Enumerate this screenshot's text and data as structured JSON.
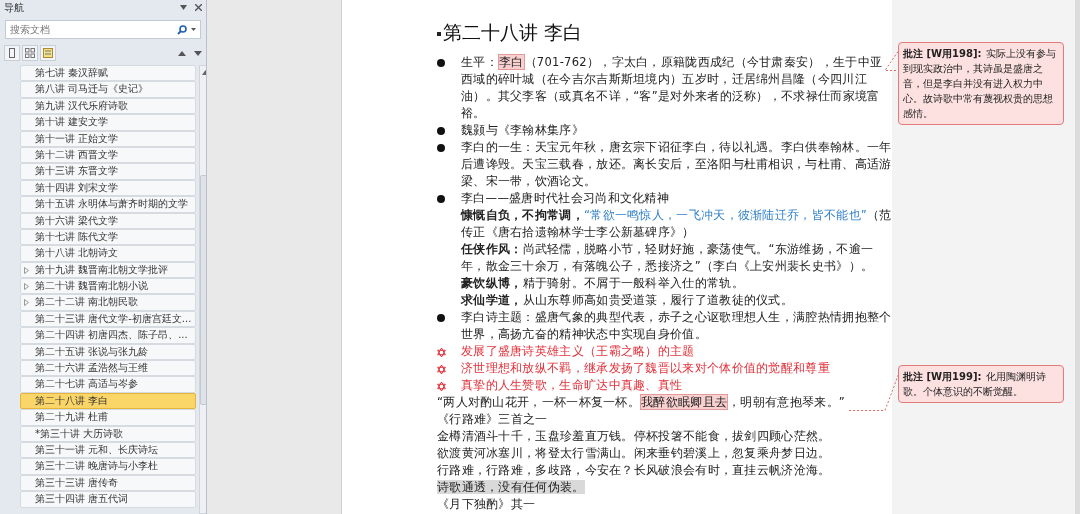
{
  "nav_pane": {
    "title": "导航",
    "search": {
      "placeholder": "搜索文档"
    },
    "items": [
      {
        "label": "第七讲 秦汉辞赋",
        "expandable": false,
        "selected": false
      },
      {
        "label": "第八讲 司马迁与《史记》",
        "expandable": false,
        "selected": false
      },
      {
        "label": "第九讲 汉代乐府诗歌",
        "expandable": false,
        "selected": false
      },
      {
        "label": "第十讲 建安文学",
        "expandable": false,
        "selected": false
      },
      {
        "label": "第十一讲 正始文学",
        "expandable": false,
        "selected": false
      },
      {
        "label": "第十二讲 西晋文学",
        "expandable": false,
        "selected": false
      },
      {
        "label": "第十三讲 东晋文学",
        "expandable": false,
        "selected": false
      },
      {
        "label": "第十四讲 刘宋文学",
        "expandable": false,
        "selected": false
      },
      {
        "label": "第十五讲 永明体与萧齐时期的文学",
        "expandable": false,
        "selected": false
      },
      {
        "label": "第十六讲 梁代文学",
        "expandable": false,
        "selected": false
      },
      {
        "label": "第十七讲 陈代文学",
        "expandable": false,
        "selected": false
      },
      {
        "label": "第十八讲 北朝诗文",
        "expandable": false,
        "selected": false
      },
      {
        "label": "第十九讲 魏晋南北朝文学批评",
        "expandable": true,
        "selected": false
      },
      {
        "label": "第二十讲 魏晋南北朝小说",
        "expandable": true,
        "selected": false
      },
      {
        "label": "第二十二讲 南北朝民歌",
        "expandable": true,
        "selected": false
      },
      {
        "label": "第二十三讲 唐代文学-初唐宫廷文...",
        "expandable": false,
        "selected": false
      },
      {
        "label": "第二十四讲 初唐四杰、陈子昂、...",
        "expandable": false,
        "selected": false
      },
      {
        "label": "第二十五讲 张说与张九龄",
        "expandable": false,
        "selected": false
      },
      {
        "label": "第二十六讲 孟浩然与王维",
        "expandable": false,
        "selected": false
      },
      {
        "label": "第二十七讲 高适与岑参",
        "expandable": false,
        "selected": false
      },
      {
        "label": "第二十八讲 李白",
        "expandable": false,
        "selected": true
      },
      {
        "label": "第二十九讲 杜甫",
        "expandable": false,
        "selected": false
      },
      {
        "label": "*第三十讲 大历诗歌",
        "expandable": false,
        "selected": false
      },
      {
        "label": "第三十一讲 元和、长庆诗坛",
        "expandable": false,
        "selected": false
      },
      {
        "label": "第三十二讲 晚唐诗与小李杜",
        "expandable": false,
        "selected": false
      },
      {
        "label": "第三十三讲 唐传奇",
        "expandable": false,
        "selected": false
      },
      {
        "label": "第三十四讲 唐五代词",
        "expandable": false,
        "selected": false
      }
    ]
  },
  "document": {
    "paragraphs": [
      {
        "kind": "heading",
        "parts": [
          {
            "kind": "plain",
            "text": "第二十八讲 李白"
          }
        ]
      },
      {
        "kind": "bullet",
        "parts": [
          {
            "kind": "plain",
            "text": "生平："
          },
          {
            "kind": "anchor",
            "text": "李白"
          },
          {
            "kind": "plain",
            "text": "（701-762），字太白，原籍陇西成纪（今甘肃秦安），生于中亚西域的碎叶城（在今吉尔吉斯斯坦境内）五岁时，迁居绵州昌隆（今四川江油）。其父李客（或真名不详，“客”是对外来者的泛称），不求禄仕而家境富裕。"
          }
        ]
      },
      {
        "kind": "bullet",
        "parts": [
          {
            "kind": "plain",
            "text": "魏颢与《李翰林集序》"
          }
        ]
      },
      {
        "kind": "bullet",
        "parts": [
          {
            "kind": "plain",
            "text": "李白的一生：天宝元年秋，唐玄宗下诏征李白，待以礼遇。李白供奉翰林。一年后遭谗毁。天宝三载春，放还。离长安后，至洛阳与杜甫相识，与杜甫、高适游梁、宋一带，饮酒论文。"
          }
        ]
      },
      {
        "kind": "bullet",
        "parts": [
          {
            "kind": "plain",
            "text": "李白——盛唐时代社会习尚和文化精神"
          }
        ]
      },
      {
        "kind": "indent",
        "parts": [
          {
            "kind": "bold",
            "text": "慷慨自负，不拘常调，"
          },
          {
            "kind": "blue",
            "text": "“常欲一鸣惊人，一飞冲天，彼渐陆迁乔，皆不能也”"
          },
          {
            "kind": "plain",
            "text": "（范传正《唐右拾遗翰林学士李公新墓碑序》）"
          }
        ]
      },
      {
        "kind": "indent",
        "parts": [
          {
            "kind": "bold",
            "text": "任侠作风："
          },
          {
            "kind": "plain",
            "text": "尚武轻儒，脱略小节，轻财好施，豪荡使气。“东游维扬，不逾一年，散金三十余万，有落魄公子，悉接济之”（李白《上安州裴长史书》）。"
          }
        ]
      },
      {
        "kind": "indent",
        "parts": [
          {
            "kind": "bold",
            "text": "豪饮纵博，"
          },
          {
            "kind": "plain",
            "text": "精于骑射。不屑于一般科举入仕的常轨。"
          }
        ]
      },
      {
        "kind": "indent",
        "parts": [
          {
            "kind": "bold",
            "text": "求仙学道，"
          },
          {
            "kind": "plain",
            "text": "从山东尊师高如贵受道箓，履行了道教徒的仪式。"
          }
        ]
      },
      {
        "kind": "bullet",
        "parts": [
          {
            "kind": "plain",
            "text": "李白诗主题：盛唐气象的典型代表，赤子之心讴歌理想人生，满腔热情拥抱整个世界，高扬亢奋的精神状态中实现自身价值。"
          }
        ]
      },
      {
        "kind": "star",
        "parts": [
          {
            "kind": "plain",
            "text": "发展了盛唐诗英雄主义（王霸之略）的主题"
          }
        ]
      },
      {
        "kind": "star",
        "parts": [
          {
            "kind": "plain",
            "text": "济世理想和放纵不羁，继承发扬了魏晋以来对个体价值的觉醒和尊重"
          }
        ]
      },
      {
        "kind": "star",
        "parts": [
          {
            "kind": "plain",
            "text": "真挚的人生赞歌，生命旷达中真趣、真性"
          }
        ]
      },
      {
        "kind": "plain",
        "parts": [
          {
            "kind": "plain",
            "text": "“两人对酌山花开，一杯一杯复一杯。"
          },
          {
            "kind": "anchor",
            "text": "我醉欲眠卿且去"
          },
          {
            "kind": "plain",
            "text": "，明朝有意抱琴来。”"
          }
        ]
      },
      {
        "kind": "plain",
        "parts": [
          {
            "kind": "plain",
            "text": "《行路难》三首之一"
          }
        ]
      },
      {
        "kind": "plain",
        "parts": [
          {
            "kind": "plain",
            "text": "金樽清酒斗十千，玉盘珍羞直万钱。停杯投箸不能食，拔剑四顾心茫然。"
          }
        ]
      },
      {
        "kind": "plain",
        "parts": [
          {
            "kind": "plain",
            "text": "欲渡黄河冰塞川，将登太行雪满山。闲来垂钓碧溪上，忽复乘舟梦日边。"
          }
        ]
      },
      {
        "kind": "plain",
        "parts": [
          {
            "kind": "plain",
            "text": "行路难，行路难，多歧路，今安在？长风破浪会有时，直挂云帆济沧海。"
          }
        ]
      },
      {
        "kind": "shaded",
        "parts": [
          {
            "kind": "plain",
            "text": "诗歌通透，没有任何伪装。"
          }
        ]
      },
      {
        "kind": "plain",
        "parts": [
          {
            "kind": "plain",
            "text": "《月下独酌》其一"
          }
        ]
      }
    ]
  },
  "comments": [
    {
      "label": "批注 [W用198]:",
      "text": "实际上没有参与到现实政治中，其诗虽是盛唐之音，但是李白并没有进入权力中心。故诗歌中常有蔑视权贵的思想感情。"
    },
    {
      "label": "批注 [W用199]:",
      "text": "化用陶渊明诗歌。个体意识的不断觉醒。"
    }
  ]
}
